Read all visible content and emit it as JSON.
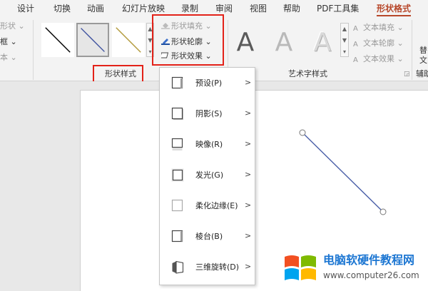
{
  "tabs": [
    {
      "label": "设计"
    },
    {
      "label": "切换"
    },
    {
      "label": "动画"
    },
    {
      "label": "幻灯片放映"
    },
    {
      "label": "录制"
    },
    {
      "label": "审阅"
    },
    {
      "label": "视图"
    },
    {
      "label": "帮助"
    },
    {
      "label": "PDF工具集"
    },
    {
      "label": "形状格式",
      "active": true
    }
  ],
  "ribbon": {
    "left_partial": [
      "形状 ⌄",
      "框 ⌄",
      "本 ⌄"
    ],
    "shape_fill": "形状填充 ⌄",
    "shape_outline": "形状轮廓 ⌄",
    "shape_effects": "形状效果 ⌄",
    "shape_styles_label": "形状样式",
    "text_fill": "文本填充 ⌄",
    "text_outline": "文本轮廓 ⌄",
    "text_effects": "文本效果 ⌄",
    "wordart_label": "艺术字样式",
    "wordart_glyph": "A",
    "right_partial_top": "替",
    "right_partial_mid": "文",
    "right_partial_label": "辅助",
    "gallery_line_colors": [
      "#000000",
      "#3b4f9e",
      "#b29a3a"
    ]
  },
  "menu": {
    "items": [
      {
        "label": "预设(P)",
        "arrow": ">"
      },
      {
        "label": "阴影(S)",
        "arrow": ">"
      },
      {
        "label": "映像(R)",
        "arrow": ">"
      },
      {
        "label": "发光(G)",
        "arrow": ">"
      },
      {
        "label": "柔化边缘(E)",
        "arrow": ">"
      },
      {
        "label": "棱台(B)",
        "arrow": ">"
      },
      {
        "label": "三维旋转(D)",
        "arrow": ">"
      }
    ]
  },
  "watermark": {
    "title": "电脑软硬件教程网",
    "url": "www.computer26.com"
  },
  "colors": {
    "accent": "#b7472a",
    "highlight_box": "#e32219",
    "watermark_blue": "#1c76d2"
  }
}
